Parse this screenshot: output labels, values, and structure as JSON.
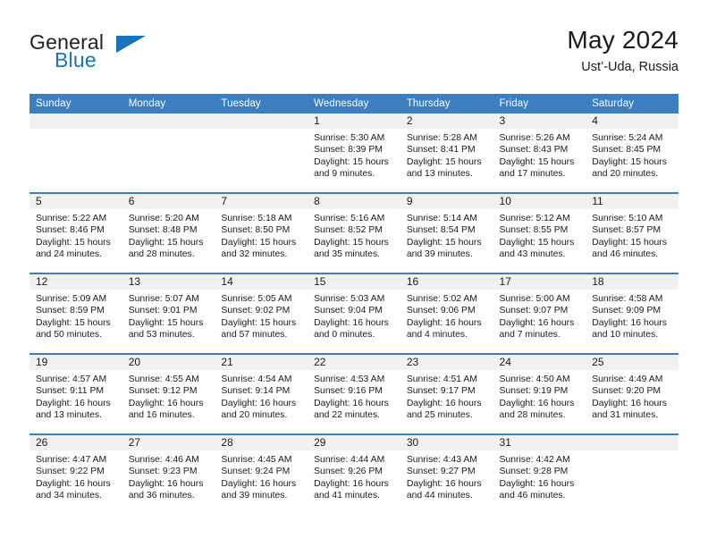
{
  "brand": {
    "name_part1": "General",
    "name_part2": "Blue",
    "accent_color": "#1574bb",
    "triangle_icon": "brand-triangle-icon"
  },
  "header": {
    "title": "May 2024",
    "subtitle": "Ust’-Uda, Russia"
  },
  "calendar": {
    "header_bg": "#3c7fc1",
    "daynum_bg": "#f1f1f1",
    "weekday_headers": [
      "Sunday",
      "Monday",
      "Tuesday",
      "Wednesday",
      "Thursday",
      "Friday",
      "Saturday"
    ],
    "weeks": [
      [
        {
          "day": "",
          "sunrise": "",
          "sunset": "",
          "daylight1": "",
          "daylight2": ""
        },
        {
          "day": "",
          "sunrise": "",
          "sunset": "",
          "daylight1": "",
          "daylight2": ""
        },
        {
          "day": "",
          "sunrise": "",
          "sunset": "",
          "daylight1": "",
          "daylight2": ""
        },
        {
          "day": "1",
          "sunrise": "Sunrise: 5:30 AM",
          "sunset": "Sunset: 8:39 PM",
          "daylight1": "Daylight: 15 hours",
          "daylight2": "and 9 minutes."
        },
        {
          "day": "2",
          "sunrise": "Sunrise: 5:28 AM",
          "sunset": "Sunset: 8:41 PM",
          "daylight1": "Daylight: 15 hours",
          "daylight2": "and 13 minutes."
        },
        {
          "day": "3",
          "sunrise": "Sunrise: 5:26 AM",
          "sunset": "Sunset: 8:43 PM",
          "daylight1": "Daylight: 15 hours",
          "daylight2": "and 17 minutes."
        },
        {
          "day": "4",
          "sunrise": "Sunrise: 5:24 AM",
          "sunset": "Sunset: 8:45 PM",
          "daylight1": "Daylight: 15 hours",
          "daylight2": "and 20 minutes."
        }
      ],
      [
        {
          "day": "5",
          "sunrise": "Sunrise: 5:22 AM",
          "sunset": "Sunset: 8:46 PM",
          "daylight1": "Daylight: 15 hours",
          "daylight2": "and 24 minutes."
        },
        {
          "day": "6",
          "sunrise": "Sunrise: 5:20 AM",
          "sunset": "Sunset: 8:48 PM",
          "daylight1": "Daylight: 15 hours",
          "daylight2": "and 28 minutes."
        },
        {
          "day": "7",
          "sunrise": "Sunrise: 5:18 AM",
          "sunset": "Sunset: 8:50 PM",
          "daylight1": "Daylight: 15 hours",
          "daylight2": "and 32 minutes."
        },
        {
          "day": "8",
          "sunrise": "Sunrise: 5:16 AM",
          "sunset": "Sunset: 8:52 PM",
          "daylight1": "Daylight: 15 hours",
          "daylight2": "and 35 minutes."
        },
        {
          "day": "9",
          "sunrise": "Sunrise: 5:14 AM",
          "sunset": "Sunset: 8:54 PM",
          "daylight1": "Daylight: 15 hours",
          "daylight2": "and 39 minutes."
        },
        {
          "day": "10",
          "sunrise": "Sunrise: 5:12 AM",
          "sunset": "Sunset: 8:55 PM",
          "daylight1": "Daylight: 15 hours",
          "daylight2": "and 43 minutes."
        },
        {
          "day": "11",
          "sunrise": "Sunrise: 5:10 AM",
          "sunset": "Sunset: 8:57 PM",
          "daylight1": "Daylight: 15 hours",
          "daylight2": "and 46 minutes."
        }
      ],
      [
        {
          "day": "12",
          "sunrise": "Sunrise: 5:09 AM",
          "sunset": "Sunset: 8:59 PM",
          "daylight1": "Daylight: 15 hours",
          "daylight2": "and 50 minutes."
        },
        {
          "day": "13",
          "sunrise": "Sunrise: 5:07 AM",
          "sunset": "Sunset: 9:01 PM",
          "daylight1": "Daylight: 15 hours",
          "daylight2": "and 53 minutes."
        },
        {
          "day": "14",
          "sunrise": "Sunrise: 5:05 AM",
          "sunset": "Sunset: 9:02 PM",
          "daylight1": "Daylight: 15 hours",
          "daylight2": "and 57 minutes."
        },
        {
          "day": "15",
          "sunrise": "Sunrise: 5:03 AM",
          "sunset": "Sunset: 9:04 PM",
          "daylight1": "Daylight: 16 hours",
          "daylight2": "and 0 minutes."
        },
        {
          "day": "16",
          "sunrise": "Sunrise: 5:02 AM",
          "sunset": "Sunset: 9:06 PM",
          "daylight1": "Daylight: 16 hours",
          "daylight2": "and 4 minutes."
        },
        {
          "day": "17",
          "sunrise": "Sunrise: 5:00 AM",
          "sunset": "Sunset: 9:07 PM",
          "daylight1": "Daylight: 16 hours",
          "daylight2": "and 7 minutes."
        },
        {
          "day": "18",
          "sunrise": "Sunrise: 4:58 AM",
          "sunset": "Sunset: 9:09 PM",
          "daylight1": "Daylight: 16 hours",
          "daylight2": "and 10 minutes."
        }
      ],
      [
        {
          "day": "19",
          "sunrise": "Sunrise: 4:57 AM",
          "sunset": "Sunset: 9:11 PM",
          "daylight1": "Daylight: 16 hours",
          "daylight2": "and 13 minutes."
        },
        {
          "day": "20",
          "sunrise": "Sunrise: 4:55 AM",
          "sunset": "Sunset: 9:12 PM",
          "daylight1": "Daylight: 16 hours",
          "daylight2": "and 16 minutes."
        },
        {
          "day": "21",
          "sunrise": "Sunrise: 4:54 AM",
          "sunset": "Sunset: 9:14 PM",
          "daylight1": "Daylight: 16 hours",
          "daylight2": "and 20 minutes."
        },
        {
          "day": "22",
          "sunrise": "Sunrise: 4:53 AM",
          "sunset": "Sunset: 9:16 PM",
          "daylight1": "Daylight: 16 hours",
          "daylight2": "and 22 minutes."
        },
        {
          "day": "23",
          "sunrise": "Sunrise: 4:51 AM",
          "sunset": "Sunset: 9:17 PM",
          "daylight1": "Daylight: 16 hours",
          "daylight2": "and 25 minutes."
        },
        {
          "day": "24",
          "sunrise": "Sunrise: 4:50 AM",
          "sunset": "Sunset: 9:19 PM",
          "daylight1": "Daylight: 16 hours",
          "daylight2": "and 28 minutes."
        },
        {
          "day": "25",
          "sunrise": "Sunrise: 4:49 AM",
          "sunset": "Sunset: 9:20 PM",
          "daylight1": "Daylight: 16 hours",
          "daylight2": "and 31 minutes."
        }
      ],
      [
        {
          "day": "26",
          "sunrise": "Sunrise: 4:47 AM",
          "sunset": "Sunset: 9:22 PM",
          "daylight1": "Daylight: 16 hours",
          "daylight2": "and 34 minutes."
        },
        {
          "day": "27",
          "sunrise": "Sunrise: 4:46 AM",
          "sunset": "Sunset: 9:23 PM",
          "daylight1": "Daylight: 16 hours",
          "daylight2": "and 36 minutes."
        },
        {
          "day": "28",
          "sunrise": "Sunrise: 4:45 AM",
          "sunset": "Sunset: 9:24 PM",
          "daylight1": "Daylight: 16 hours",
          "daylight2": "and 39 minutes."
        },
        {
          "day": "29",
          "sunrise": "Sunrise: 4:44 AM",
          "sunset": "Sunset: 9:26 PM",
          "daylight1": "Daylight: 16 hours",
          "daylight2": "and 41 minutes."
        },
        {
          "day": "30",
          "sunrise": "Sunrise: 4:43 AM",
          "sunset": "Sunset: 9:27 PM",
          "daylight1": "Daylight: 16 hours",
          "daylight2": "and 44 minutes."
        },
        {
          "day": "31",
          "sunrise": "Sunrise: 4:42 AM",
          "sunset": "Sunset: 9:28 PM",
          "daylight1": "Daylight: 16 hours",
          "daylight2": "and 46 minutes."
        },
        {
          "day": "",
          "sunrise": "",
          "sunset": "",
          "daylight1": "",
          "daylight2": ""
        }
      ]
    ]
  }
}
